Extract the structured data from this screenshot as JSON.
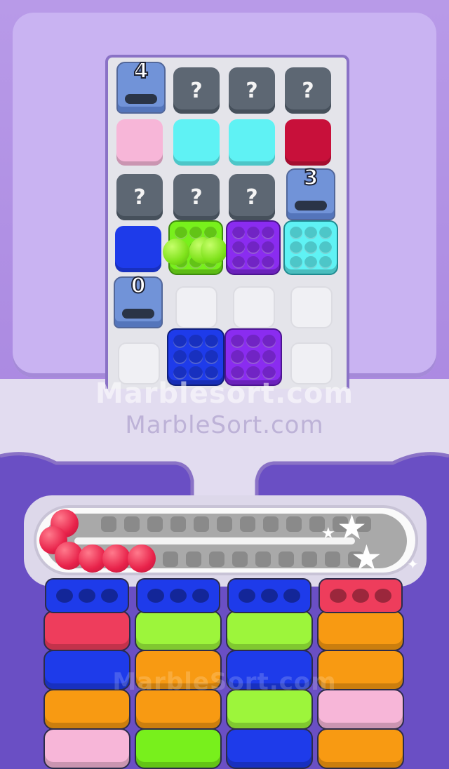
{
  "watermark": {
    "line1": "Marblesort.com",
    "line2": "MarbleSort.com",
    "line3": "MarbleSort.com"
  },
  "spawners": [
    {
      "count": "4"
    },
    {
      "count": "3"
    },
    {
      "count": "0"
    }
  ],
  "hidden_label": "?",
  "colors": {
    "pink": "#f7b6d8",
    "cyan": "#5ff2f4",
    "crimson": "#c8103a",
    "blue": "#1e3bea",
    "lime": "#78f01c",
    "purple": "#8a2cf0",
    "orange": "#f89a12",
    "red": "#ee3d5c",
    "green": "#9df53b"
  },
  "queue_marbles": 7
}
